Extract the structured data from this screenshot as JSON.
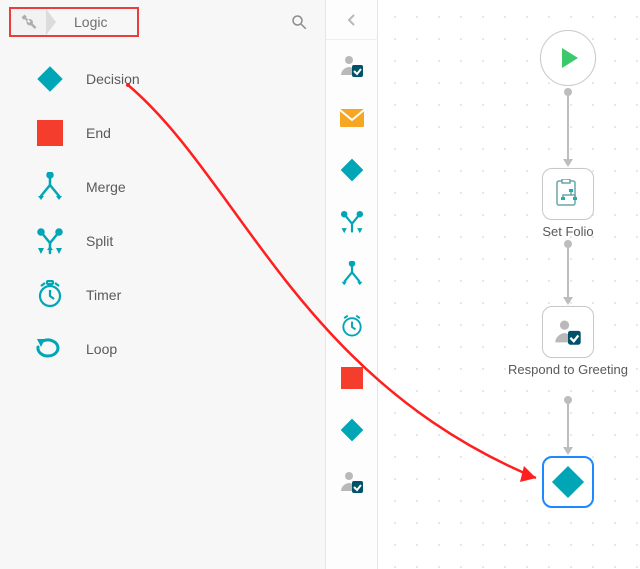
{
  "breadcrumb": {
    "label": "Logic"
  },
  "palette": [
    {
      "name": "decision",
      "label": "Decision",
      "icon": "diamond-teal"
    },
    {
      "name": "end",
      "label": "End",
      "icon": "square-red"
    },
    {
      "name": "merge",
      "label": "Merge",
      "icon": "merge-teal"
    },
    {
      "name": "split",
      "label": "Split",
      "icon": "split-teal"
    },
    {
      "name": "timer",
      "label": "Timer",
      "icon": "clock-teal"
    },
    {
      "name": "loop",
      "label": "Loop",
      "icon": "loop-teal"
    }
  ],
  "strip": [
    {
      "name": "person-check",
      "icon": "person-check"
    },
    {
      "name": "mail",
      "icon": "mail-orange"
    },
    {
      "name": "diamond",
      "icon": "diamond-teal"
    },
    {
      "name": "split",
      "icon": "split-teal"
    },
    {
      "name": "merge",
      "icon": "merge-teal"
    },
    {
      "name": "clock",
      "icon": "clock-teal"
    },
    {
      "name": "square",
      "icon": "square-red"
    },
    {
      "name": "diamond2",
      "icon": "diamond-teal"
    },
    {
      "name": "person2",
      "icon": "person-check"
    }
  ],
  "canvas": {
    "nodes": {
      "start": {
        "label": ""
      },
      "setFolio": {
        "label": "Set Folio"
      },
      "respond": {
        "label": "Respond to Greeting"
      },
      "drop": {
        "label": ""
      }
    }
  }
}
